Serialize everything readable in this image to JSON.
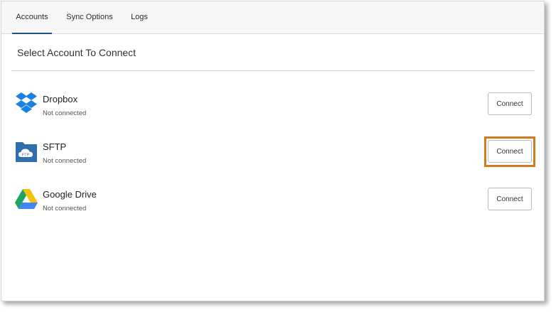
{
  "tabs": [
    {
      "label": "Accounts",
      "active": true
    },
    {
      "label": "Sync Options",
      "active": false
    },
    {
      "label": "Logs",
      "active": false
    }
  ],
  "heading": "Select Account To Connect",
  "accounts": [
    {
      "name": "Dropbox",
      "status": "Not connected",
      "button": "Connect",
      "icon": "dropbox-icon"
    },
    {
      "name": "SFTP",
      "status": "Not connected",
      "button": "Connect",
      "icon": "sftp-icon",
      "icon_label": "FTP"
    },
    {
      "name": "Google Drive",
      "status": "Not connected",
      "button": "Connect",
      "icon": "google-drive-icon"
    }
  ],
  "colors": {
    "active_tab_underline": "#1f4e8c",
    "highlight_box": "#d27a1e",
    "dropbox_blue": "#1a82e2",
    "sftp_blue": "#2f6fae"
  }
}
